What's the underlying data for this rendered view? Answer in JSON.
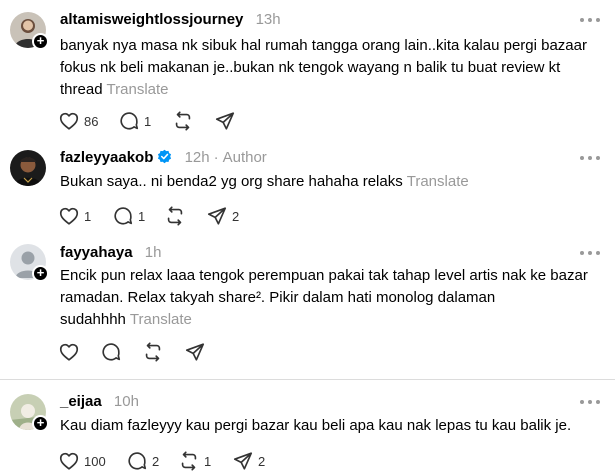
{
  "posts": [
    {
      "username": "altamisweightlossjourney",
      "time": "13h",
      "text": "banyak nya masa nk sibuk hal rumah tangga orang lain..kita kalau pergi bazaar fokus nk beli makanan je..bukan nk tengok wayang n balik tu buat review kt thread",
      "translate": "Translate",
      "likes": "86",
      "replies": "1",
      "reposts": "",
      "shares": ""
    },
    {
      "username": "fazleyyaakob",
      "time": "12h",
      "author_label": "Author",
      "text": "Bukan saya.. ni benda2 yg org share hahaha relaks",
      "translate": "Translate",
      "likes": "1",
      "replies": "1",
      "reposts": "",
      "shares": "2"
    },
    {
      "username": "fayyahaya",
      "time": "1h",
      "text": "Encik pun relax laaa tengok perempuan pakai tak tahap level artis nak ke bazar ramadan. Relax takyah share². Pikir dalam hati monolog dalaman sudahhhh",
      "translate": "Translate",
      "likes": "",
      "replies": "",
      "reposts": "",
      "shares": ""
    },
    {
      "username": "_eijaa",
      "time": "10h",
      "text": "Kau diam fazleyyy kau pergi bazar kau beli apa kau nak lepas tu kau balik je.",
      "translate": "",
      "likes": "100",
      "replies": "2",
      "reposts": "1",
      "shares": "2"
    }
  ],
  "icons": {
    "like": "heart-icon",
    "reply": "speech-bubble-icon",
    "repost": "repost-arrows-icon",
    "share": "paper-plane-icon",
    "more": "more-options-icon",
    "follow": "plus-icon",
    "verified": "verified-badge-icon"
  },
  "colors": {
    "muted": "#999999",
    "verified": "#0095f6",
    "divider": "#dcdcdc"
  }
}
